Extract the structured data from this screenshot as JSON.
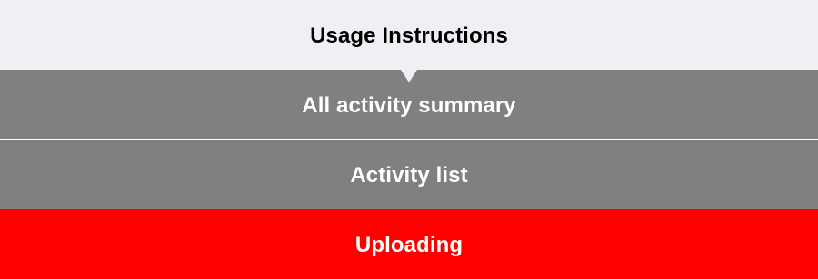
{
  "menu": {
    "usage_instructions": "Usage Instructions",
    "all_activity_summary": "All activity summary",
    "activity_list": "Activity list",
    "uploading": "Uploading"
  },
  "colors": {
    "header_bg": "#eff0f4",
    "item_bg": "#808080",
    "active_bg": "#ff0000",
    "item_text": "#ffffff",
    "header_text": "#000000"
  }
}
